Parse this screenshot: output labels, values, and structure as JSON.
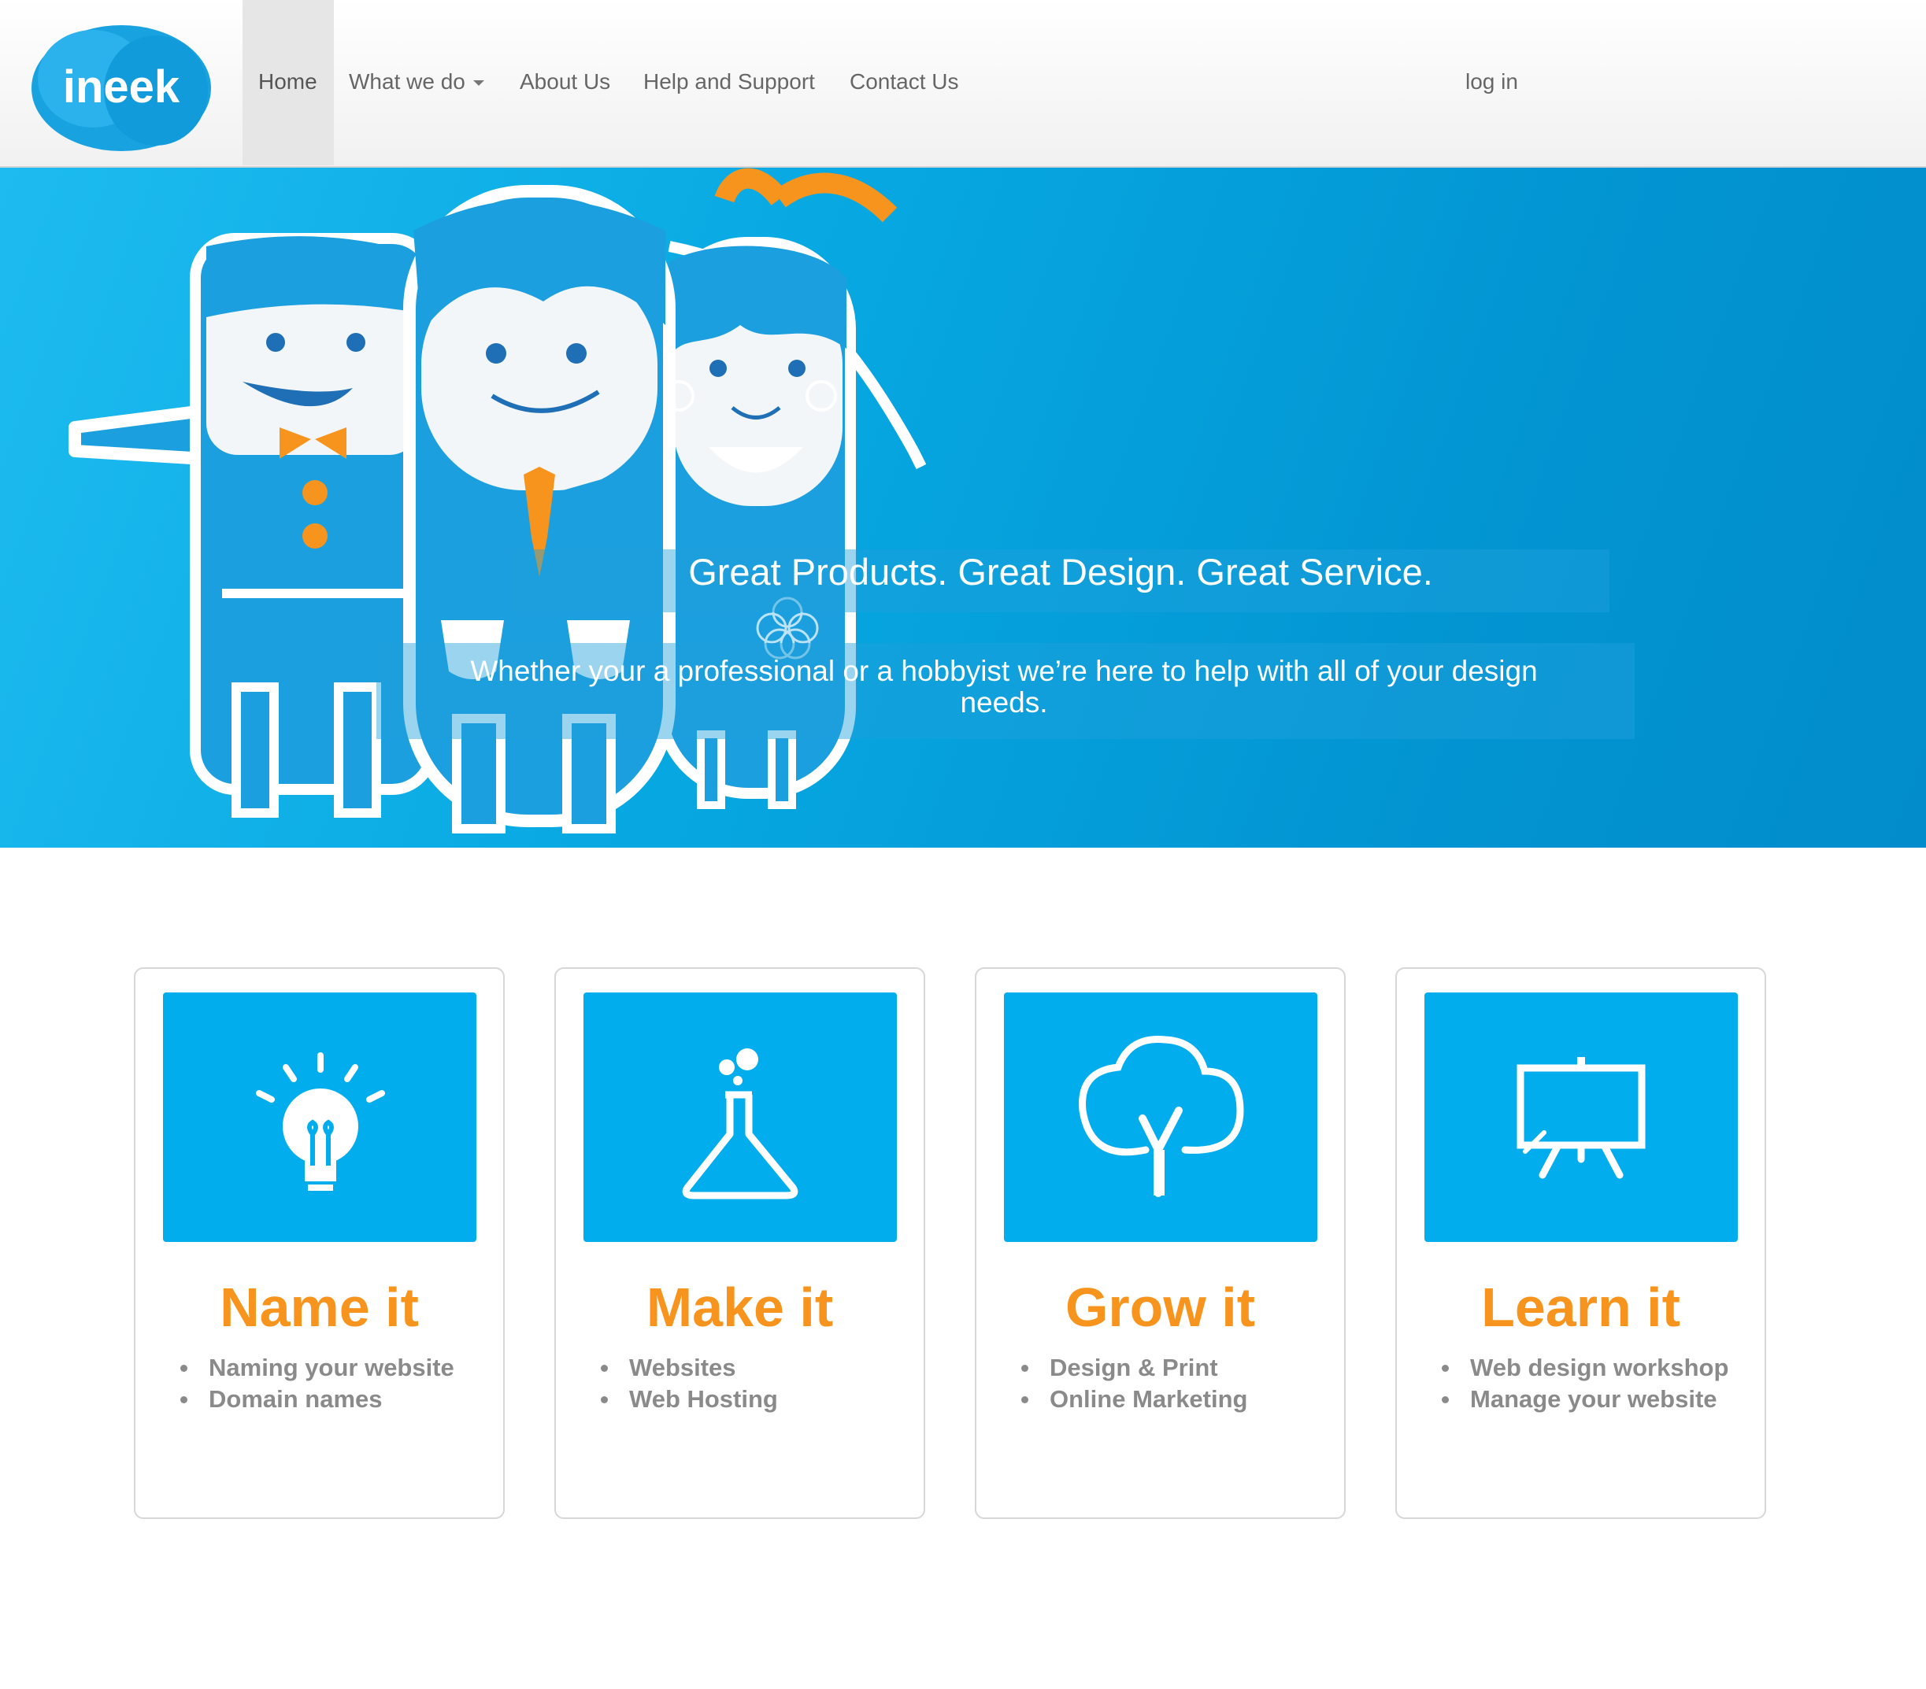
{
  "brand": {
    "logo_text": "ineek"
  },
  "nav": {
    "items": [
      {
        "label": "Home",
        "active": true
      },
      {
        "label": "What we do",
        "dropdown": true
      },
      {
        "label": "About Us"
      },
      {
        "label": "Help and Support"
      },
      {
        "label": "Contact Us"
      }
    ],
    "login_label": "log in"
  },
  "hero": {
    "title": "Great Products. Great Design. Great Service.",
    "subtitle": "Whether your a professional or a hobbyist we’re here to help with all of your design needs."
  },
  "cards": [
    {
      "icon": "lightbulb-icon",
      "title": "Name it",
      "items": [
        "Naming your website",
        "Domain names"
      ]
    },
    {
      "icon": "flask-icon",
      "title": "Make it",
      "items": [
        "Websites",
        "Web Hosting"
      ]
    },
    {
      "icon": "tree-icon",
      "title": "Grow it",
      "items": [
        "Design & Print",
        "Online Marketing"
      ]
    },
    {
      "icon": "presentation-board-icon",
      "title": "Learn it",
      "items": [
        "Web design workshop",
        "Manage your website"
      ]
    }
  ],
  "colors": {
    "brand_blue": "#02adee",
    "accent_orange": "#f7941d",
    "hero_blue": "#0295d2"
  }
}
